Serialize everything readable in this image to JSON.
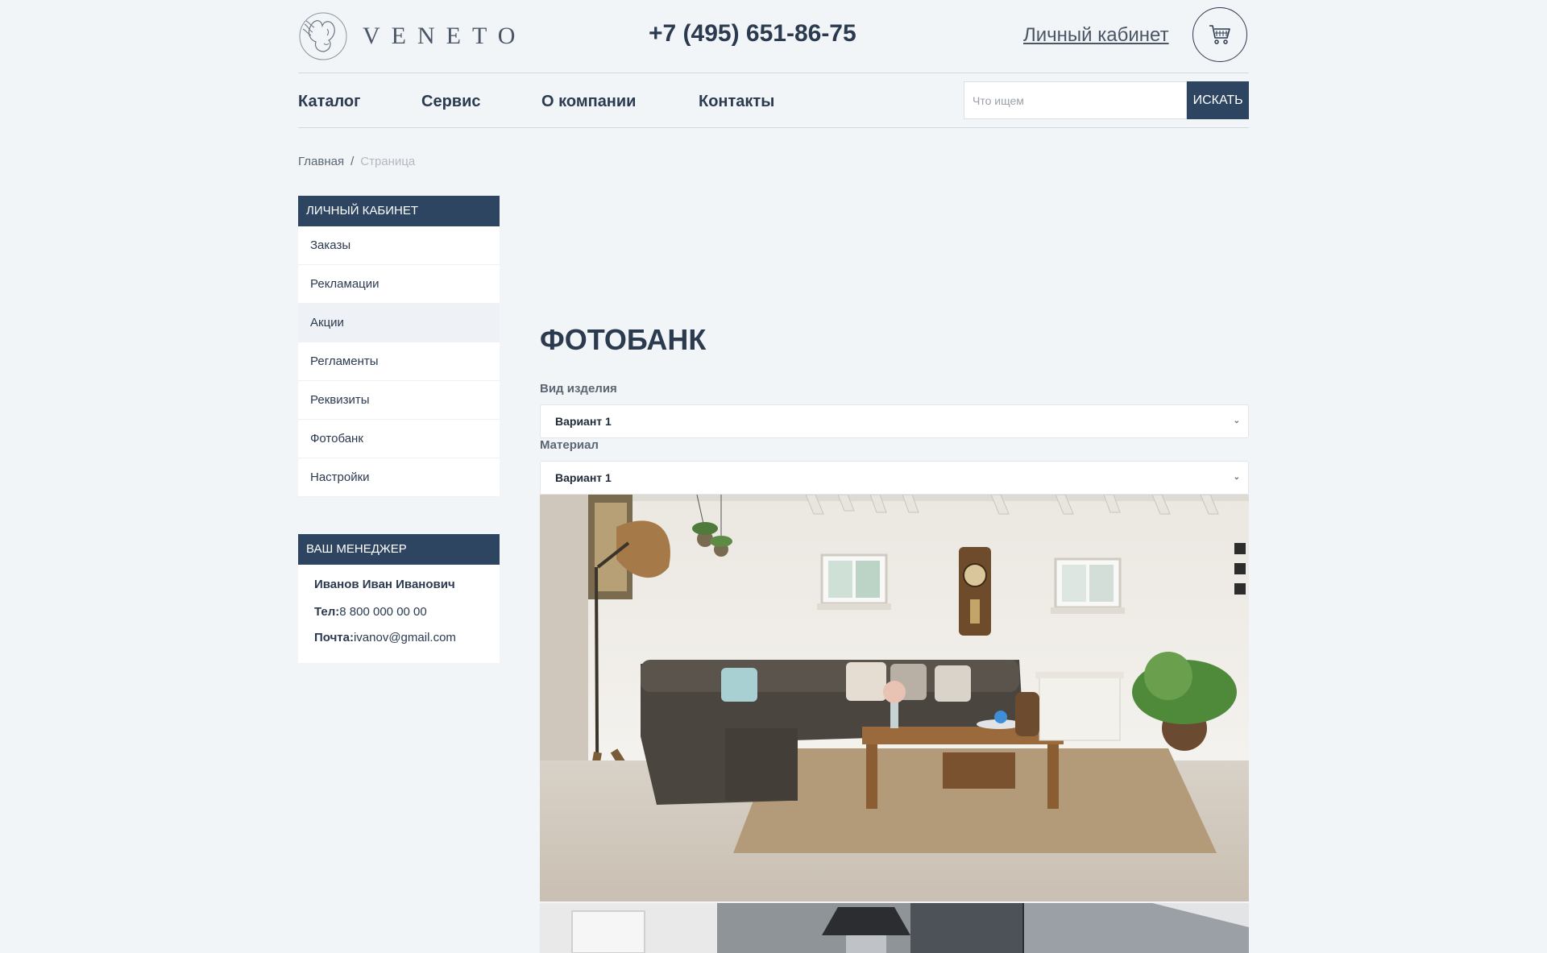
{
  "header": {
    "logo_text": "VENETO",
    "phone": "+7 (495) 651-86-75",
    "account_link": "Личный кабинет",
    "cart_icon": "cart-icon"
  },
  "nav": {
    "items": [
      "Каталог",
      "Сервис",
      "О компании",
      "Контакты"
    ],
    "search_placeholder": "Что ищем",
    "search_button": "ИСКАТЬ"
  },
  "breadcrumb": {
    "home": "Главная",
    "separator": "/",
    "current": "Страница"
  },
  "sidebar": {
    "title": "Личный кабинет",
    "items": [
      "Заказы",
      "Рекламации",
      "Акции",
      "Регламенты",
      "Реквизиты",
      "Фотобанк",
      "Настройки"
    ],
    "active_item": "Акции"
  },
  "manager": {
    "title": "Ваш менеджер",
    "name": "Иванов Иван Иванович",
    "phone_label": "Тел:",
    "phone": "8 800 000 00 00",
    "email_label": "Почта:",
    "email": "ivanov@gmail.com"
  },
  "main": {
    "title": "Фотобанк",
    "product_type_label": "Вид изделия",
    "product_type_value": "Вариант 1",
    "material_label": "Материал",
    "material_value": "Вариант 1"
  },
  "colors": {
    "accent": "#2e4561",
    "background": "#f2f5f8"
  }
}
